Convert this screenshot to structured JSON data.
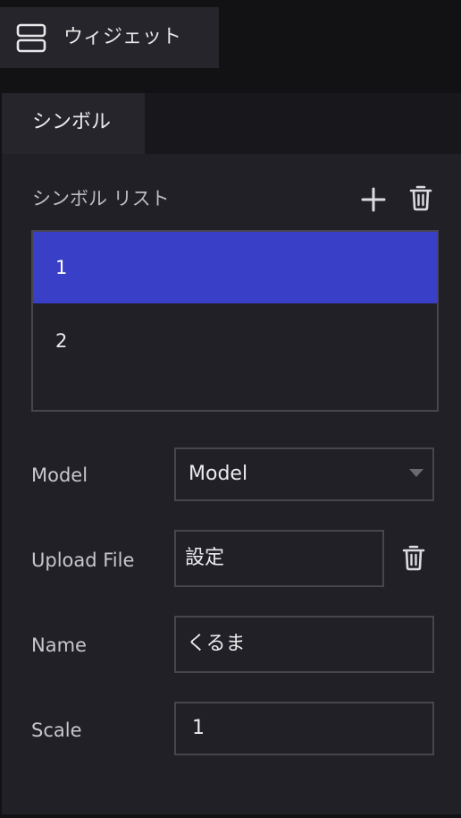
{
  "header": {
    "title": "ウィジェット",
    "icon": "widget-layout-icon"
  },
  "panel": {
    "active_tab": "シンボル"
  },
  "symbol_list": {
    "title": "シンボル リスト",
    "add_icon": "plus-icon",
    "delete_icon": "trash-icon",
    "items": [
      {
        "label": "1",
        "selected": true
      },
      {
        "label": "2",
        "selected": false
      }
    ]
  },
  "form": {
    "model": {
      "label": "Model",
      "value": "Model"
    },
    "upload_file": {
      "label": "Upload File",
      "value": "設定",
      "delete_icon": "trash-icon"
    },
    "name": {
      "label": "Name",
      "value": "くるま"
    },
    "scale": {
      "label": "Scale",
      "value": "1"
    }
  },
  "colors": {
    "background": "#121215",
    "panel": "#212026",
    "tab": "#26252b",
    "border": "#47464c",
    "selected": "#3940c7",
    "text": "#ececee"
  }
}
